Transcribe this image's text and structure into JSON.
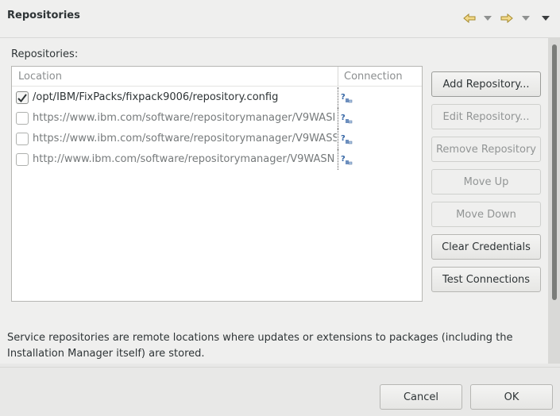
{
  "header": {
    "title": "Repositories",
    "nav_icons": [
      "back-arrow-icon",
      "dropdown-icon",
      "forward-arrow-icon",
      "dropdown-icon",
      "view-menu-icon"
    ]
  },
  "section_label": "Repositories:",
  "table": {
    "columns": [
      "Location",
      "Connection"
    ],
    "rows": [
      {
        "checked": true,
        "location": "/opt/IBM/FixPacks/fixpack9006/repository.config",
        "enabled": true,
        "connection_icon": "connection-status-icon"
      },
      {
        "checked": false,
        "location": "https://www.ibm.com/software/repositorymanager/V9WASI",
        "enabled": false,
        "connection_icon": "connection-status-icon"
      },
      {
        "checked": false,
        "location": "https://www.ibm.com/software/repositorymanager/V9WASS",
        "enabled": false,
        "connection_icon": "connection-status-icon"
      },
      {
        "checked": false,
        "location": "http://www.ibm.com/software/repositorymanager/V9WASN",
        "enabled": false,
        "connection_icon": "connection-status-icon"
      }
    ]
  },
  "buttons": {
    "add": "Add Repository...",
    "edit": "Edit Repository...",
    "remove": "Remove Repository",
    "move_up": "Move Up",
    "move_down": "Move Down",
    "clear": "Clear Credentials",
    "test": "Test Connections"
  },
  "description": "Service repositories are remote locations where updates or extensions to packages (including the Installation Manager itself) are stored.",
  "footer": {
    "cancel": "Cancel",
    "ok": "OK"
  },
  "colors": {
    "arrow_icon": "#c6a43a",
    "background": "#e8e8e7",
    "table_bg": "#ffffff"
  }
}
